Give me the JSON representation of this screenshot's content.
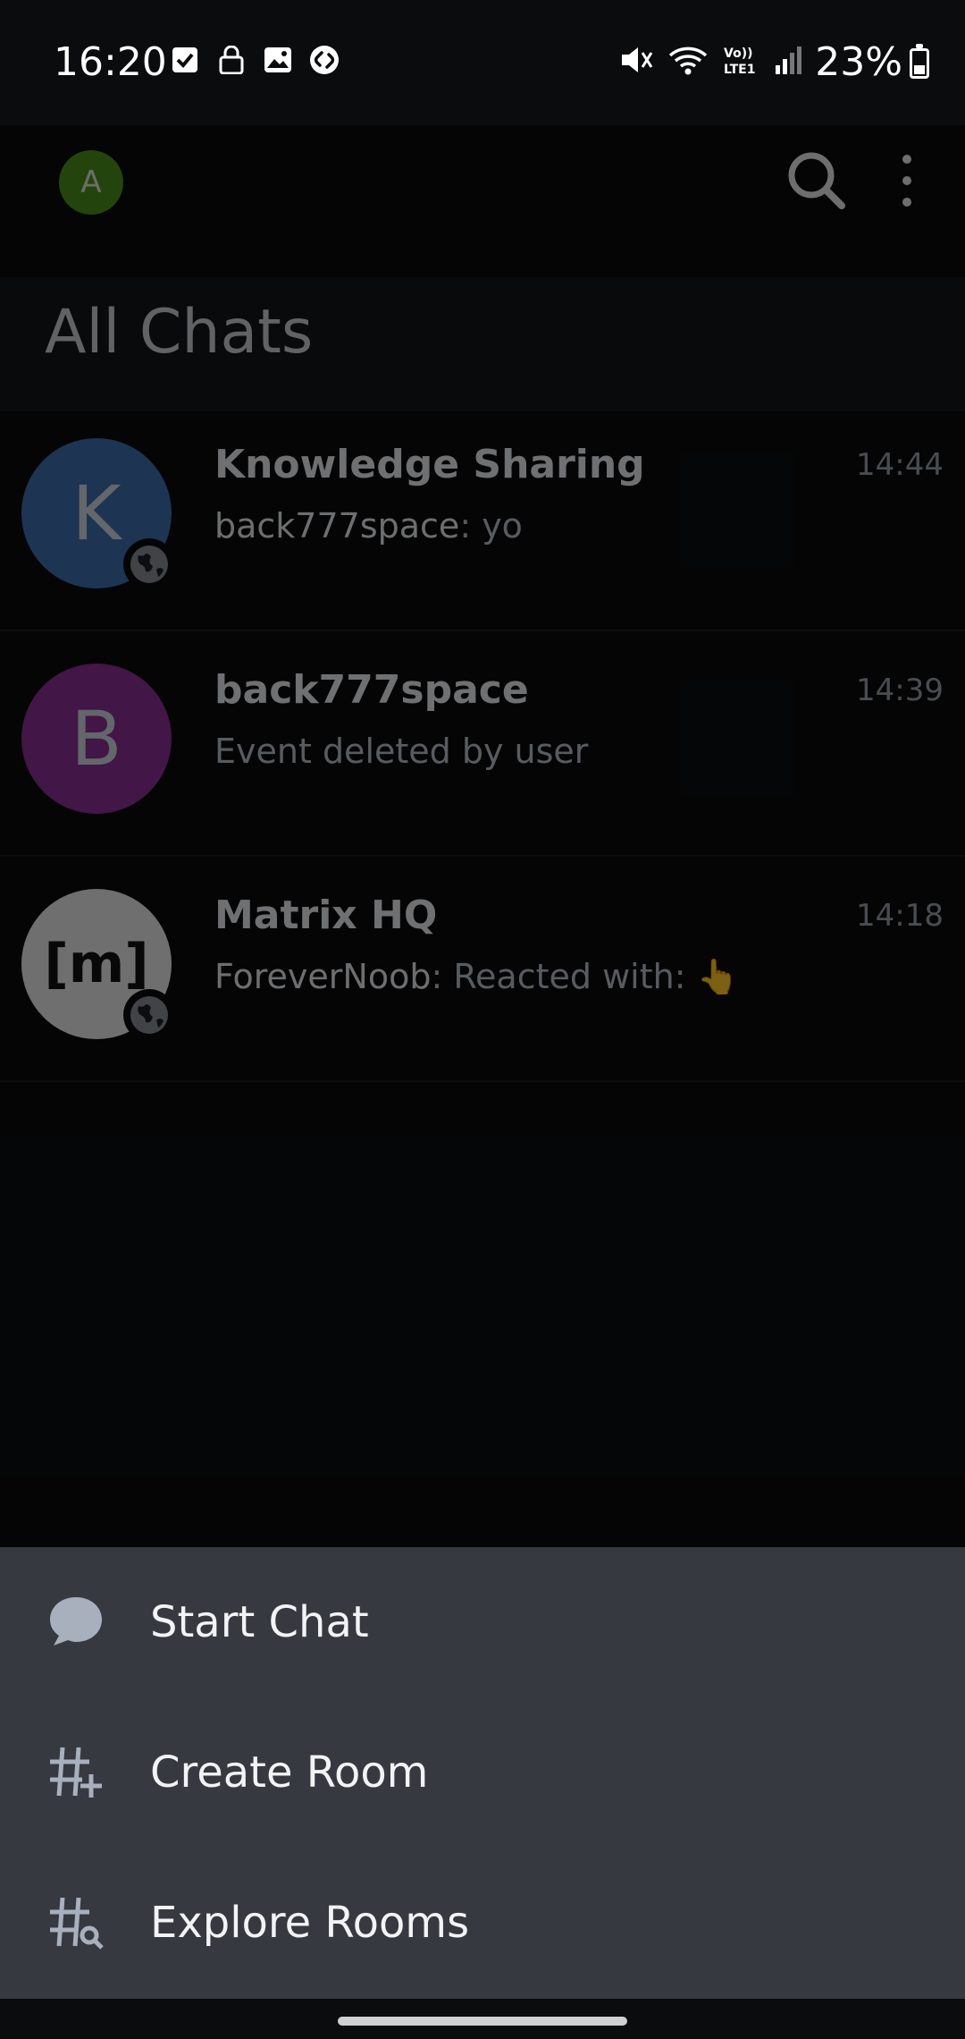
{
  "status_bar": {
    "time": "16:20",
    "battery": "23%",
    "icons_left": [
      "checkbox-icon",
      "lock-icon",
      "image-icon",
      "shazam-icon"
    ],
    "icons_right": [
      "mute-icon",
      "wifi-icon",
      "volte-icon",
      "signal-icon"
    ]
  },
  "app_bar": {
    "profile_initial": "A",
    "title": "All Chats"
  },
  "chats": [
    {
      "name": "Knowledge Sharing",
      "time": "14:44",
      "sender": "back777space",
      "text": ": yo",
      "initial": "K",
      "color": "#3f6dad",
      "public": true
    },
    {
      "name": "back777space",
      "time": "14:39",
      "sender": "",
      "text": "Event deleted by user",
      "initial": "B",
      "color": "#8b2f93",
      "public": false
    },
    {
      "name": "Matrix HQ",
      "time": "14:18",
      "sender": "ForeverNoob",
      "text": ": Reacted with: 👆",
      "initial": "[m]",
      "color": "#e8e8e8",
      "public": true
    }
  ],
  "sheet": {
    "items": [
      {
        "label": "Start Chat",
        "icon": "chat-bubble-icon"
      },
      {
        "label": "Create Room",
        "icon": "hashtag-plus-icon"
      },
      {
        "label": "Explore Rooms",
        "icon": "hashtag-search-icon"
      }
    ]
  }
}
